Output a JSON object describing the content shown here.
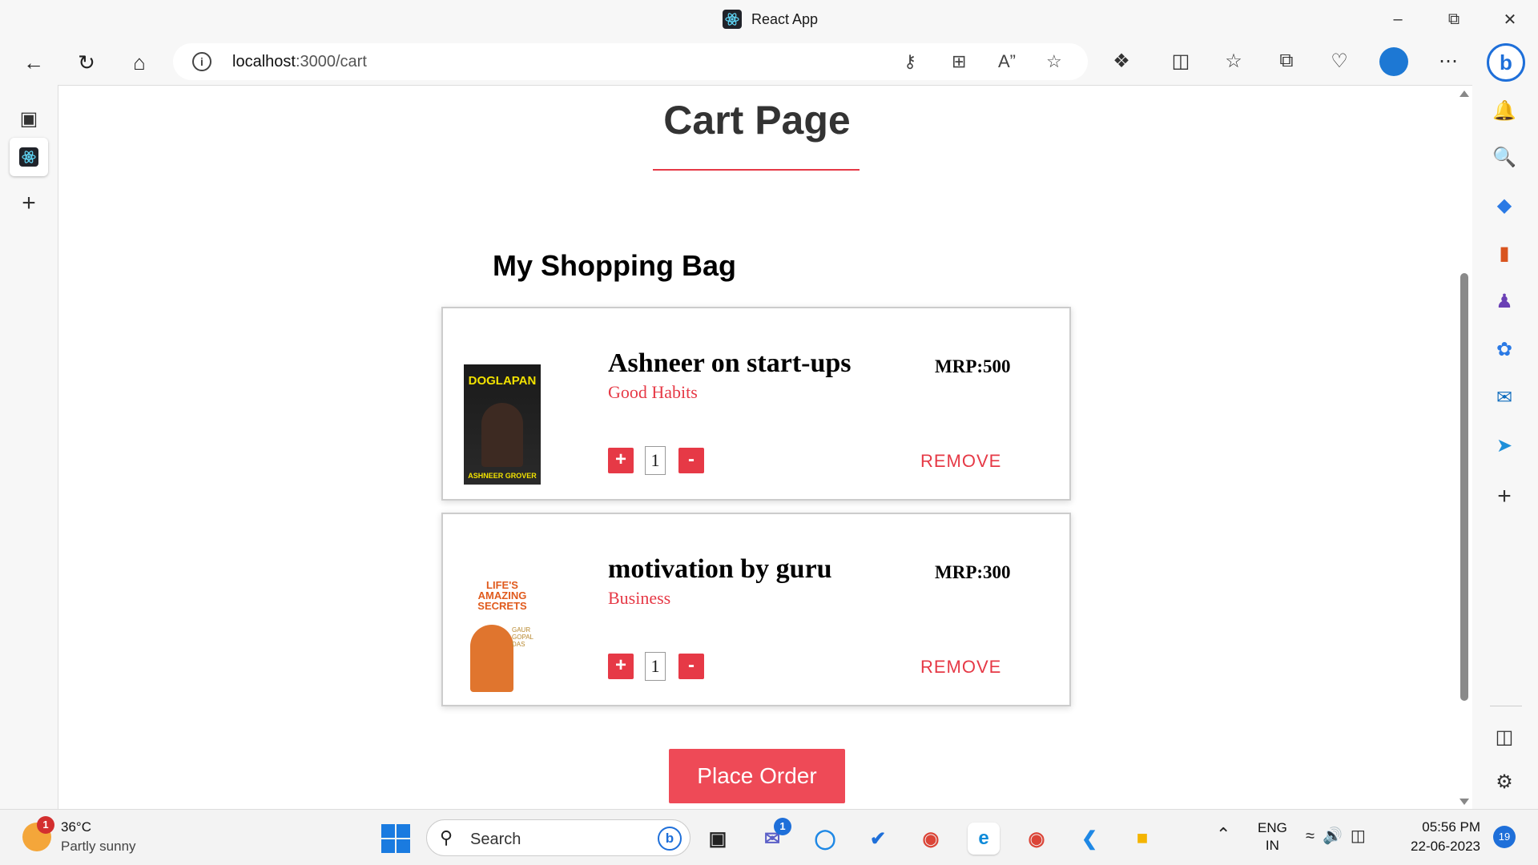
{
  "window": {
    "title": "React App"
  },
  "browser": {
    "url_host": "localhost",
    "url_path": ":3000/cart"
  },
  "page": {
    "title": "Cart Page",
    "bag_title": "My Shopping Bag",
    "place_order_label": "Place Order",
    "accent_color": "#e63946"
  },
  "cart": {
    "items": [
      {
        "name": "Ashneer on start-ups",
        "category": "Good Habits",
        "price": "MRP:500",
        "quantity": "1",
        "remove_label": "REMOVE",
        "cover_title": "DOGLAPAN",
        "cover_author": "ASHNEER GROVER"
      },
      {
        "name": "motivation by guru",
        "category": "Business",
        "price": "MRP:300",
        "quantity": "1",
        "remove_label": "REMOVE",
        "cover_title": "LIFE'S AMAZING SECRETS",
        "cover_author": "GAUR GOPAL DAS"
      }
    ]
  },
  "taskbar": {
    "temperature": "36°C",
    "weather": "Partly sunny",
    "weather_badge": "1",
    "search_label": "Search",
    "teams_badge": "1",
    "lang_top": "ENG",
    "lang_bottom": "IN",
    "time": "05:56 PM",
    "date": "22-06-2023",
    "notifications": "19"
  }
}
